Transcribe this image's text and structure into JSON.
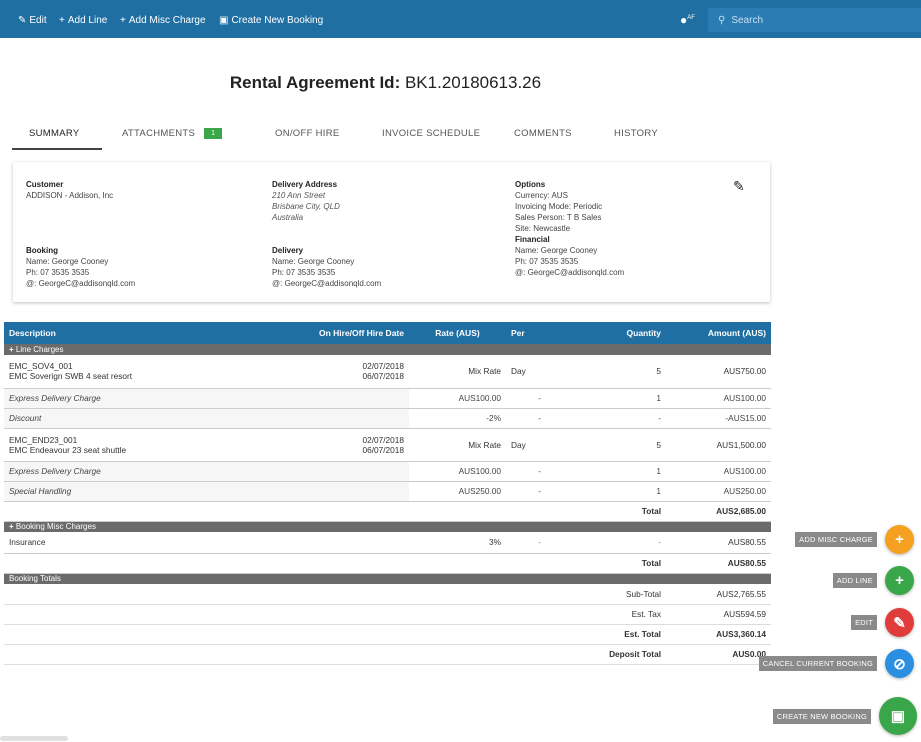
{
  "toolbar": {
    "edit": "Edit",
    "add_line": "Add Line",
    "add_misc": "Add Misc Charge",
    "create": "Create New Booking",
    "lang_badge": "AF",
    "search_placeholder": "Search",
    "color": "#1f6fa3"
  },
  "page": {
    "title_label": "Rental Agreement Id:",
    "title_value": "BK1.20180613.26"
  },
  "tabs": {
    "summary": "SUMMARY",
    "attachments": "ATTACHMENTS",
    "attachments_count": "1",
    "onoff": "ON/OFF HIRE",
    "invoice": "INVOICE SCHEDULE",
    "comments": "COMMENTS",
    "history": "HISTORY"
  },
  "summary": {
    "customer_h": "Customer",
    "customer": "ADDISON - Addison, Inc",
    "booking_h": "Booking",
    "booking_name": "Name: George Cooney",
    "booking_ph": "Ph: 07 3535 3535",
    "booking_email": "@: GeorgeC@addisonqld.com",
    "delivery_addr_h": "Delivery Address",
    "addr1": "210 Ann Street",
    "addr2": "Brisbane City, QLD",
    "addr3": "Australia",
    "delivery_h": "Delivery",
    "delivery_name": "Name: George Cooney",
    "delivery_ph": "Ph: 07 3535 3535",
    "delivery_email": "@: GeorgeC@addisonqld.com",
    "options_h": "Options",
    "currency": "Currency: AUS",
    "invoicing": "Invoicing Mode: Periodic",
    "sales": "Sales Person: T B Sales",
    "site": "Site: Newcastle",
    "financial_h": "Financial",
    "fin_name": "Name: George Cooney",
    "fin_ph": "Ph: 07 3535 3535",
    "fin_email": "@: GeorgeC@addisonqld.com"
  },
  "table": {
    "headers": {
      "description": "Description",
      "date": "On Hire/Off Hire Date",
      "rate": "Rate (AUS)",
      "per": "Per",
      "quantity": "Quantity",
      "amount": "Amount (AUS)"
    },
    "line_charges_h": "Line Charges",
    "item1": {
      "code": "EMC_SOV4_001",
      "name": "EMC Soverign SWB 4 seat resort",
      "on": "02/07/2018",
      "off": "06/07/2018",
      "rate": "Mix Rate",
      "per": "Day",
      "qty": "5",
      "amount": "AUS750.00"
    },
    "item1_subs": [
      {
        "desc": "Express Delivery Charge",
        "rate": "AUS100.00",
        "per": "-",
        "qty": "1",
        "amount": "AUS100.00"
      },
      {
        "desc": "Discount",
        "rate": "-2%",
        "per": "-",
        "qty": "-",
        "amount": "-AUS15.00"
      }
    ],
    "item2": {
      "code": "EMC_END23_001",
      "name": "EMC Endeavour 23 seat shuttle",
      "on": "02/07/2018",
      "off": "06/07/2018",
      "rate": "Mix Rate",
      "per": "Day",
      "qty": "5",
      "amount": "AUS1,500.00"
    },
    "item2_subs": [
      {
        "desc": "Express Delivery Charge",
        "rate": "AUS100.00",
        "per": "-",
        "qty": "1",
        "amount": "AUS100.00"
      },
      {
        "desc": "Special Handling",
        "rate": "AUS250.00",
        "per": "-",
        "qty": "1",
        "amount": "AUS250.00"
      }
    ],
    "line_total_label": "Total",
    "line_total": "AUS2,685.00",
    "misc_h": "Booking Misc Charges",
    "insurance": {
      "desc": "Insurance",
      "rate": "3%",
      "per": "-",
      "qty": "-",
      "amount": "AUS80.55"
    },
    "misc_total_label": "Total",
    "misc_total": "AUS80.55",
    "totals_h": "Booking Totals",
    "subtotal_label": "Sub-Total",
    "subtotal": "AUS2,765.55",
    "tax_label": "Est. Tax",
    "tax": "AUS594.59",
    "est_total_label": "Est. Total",
    "est_total": "AUS3,360.14",
    "deposit_label": "Deposit Total",
    "deposit": "AUS0.00"
  },
  "fabs": {
    "misc": {
      "label": "ADD MISC CHARGE",
      "color": "#f5a020"
    },
    "line": {
      "label": "ADD LINE",
      "color": "#3aa64a"
    },
    "edit": {
      "label": "EDIT",
      "color": "#e03c3c"
    },
    "cancel": {
      "label": "CANCEL CURRENT BOOKING",
      "color": "#2a8fe0"
    },
    "create": {
      "label": "CREATE NEW BOOKING",
      "color": "#3aa64a"
    }
  }
}
